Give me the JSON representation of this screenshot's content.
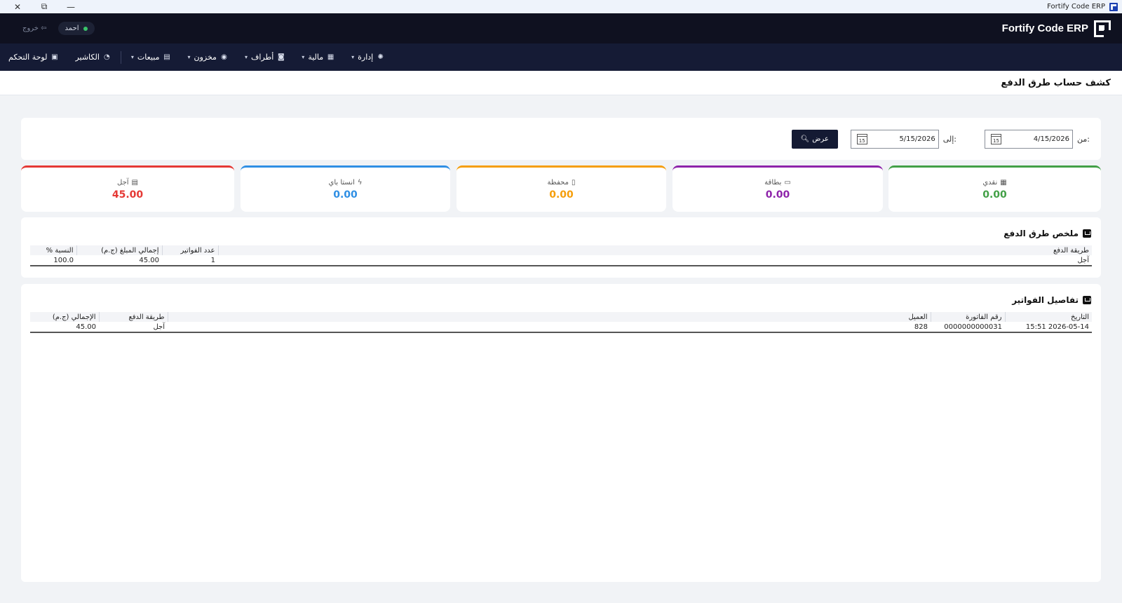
{
  "window": {
    "title": "Fortify Code ERP",
    "controls": {
      "close": "✕",
      "restore": "⧉",
      "minimize": "—"
    }
  },
  "header": {
    "brand": "Fortify Code ERP",
    "user": "احمد",
    "logout": "خروج ⇦"
  },
  "nav": {
    "items": [
      {
        "label": "لوحة التحكم",
        "icon": "dashboard-icon",
        "has_caret": false
      },
      {
        "label": "الكاشير",
        "icon": "cashier-icon",
        "has_caret": false
      },
      {
        "label": "مبيعات",
        "icon": "sales-icon",
        "has_caret": true
      },
      {
        "label": "مخزون",
        "icon": "inventory-icon",
        "has_caret": true
      },
      {
        "label": "أطراف",
        "icon": "parties-icon",
        "has_caret": true
      },
      {
        "label": "مالية",
        "icon": "finance-icon",
        "has_caret": true
      },
      {
        "label": "إدارة",
        "icon": "admin-icon",
        "has_caret": true
      }
    ]
  },
  "page": {
    "title": "كشف حساب طرق الدفع"
  },
  "filter": {
    "from_label": "من:",
    "from_value": "4/15/2026",
    "to_label": "إلى:",
    "to_value": "5/15/2026",
    "calendar_glyph": "15",
    "show_label": "عرض"
  },
  "stats": {
    "cash": {
      "label": "نقدي",
      "value": "0.00",
      "color": "#43a047"
    },
    "card": {
      "label": "بطاقة",
      "value": "0.00",
      "color": "#8e24aa"
    },
    "wallet": {
      "label": "محفظة",
      "value": "0.00",
      "color": "#f59e0b"
    },
    "insta": {
      "label": "انستا باي",
      "value": "0.00",
      "color": "#2f8fe4"
    },
    "credit": {
      "label": "آجل",
      "value": "45.00",
      "color": "#e53935"
    }
  },
  "summary": {
    "title": "ملخص طرق الدفع",
    "columns": [
      "طريقة الدفع",
      "عدد الفواتير",
      "إجمالي المبلغ (ج.م)",
      "النسبة %"
    ],
    "rows": [
      [
        "آجل",
        "1",
        "45.00",
        "100.0"
      ]
    ]
  },
  "details": {
    "title": "تفاصيل الفواتير",
    "columns": [
      "التاريخ",
      "رقم الفاتورة",
      "العميل",
      "طريقة الدفع",
      "الإجمالي (ج.م)"
    ],
    "rows": [
      [
        "2026-05-14 15:51",
        "0000000000031",
        "828",
        "آجل",
        "45.00"
      ]
    ]
  }
}
